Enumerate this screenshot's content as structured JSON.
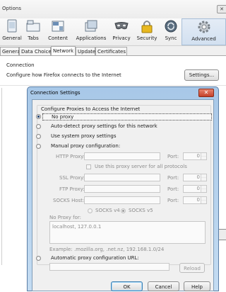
{
  "window": {
    "title": "Options",
    "close_glyph": "✕",
    "toolbar": [
      {
        "label": "General",
        "icon": "general-icon"
      },
      {
        "label": "Tabs",
        "icon": "tabs-icon"
      },
      {
        "label": "Content",
        "icon": "content-icon"
      },
      {
        "label": "Applications",
        "icon": "applications-icon"
      },
      {
        "label": "Privacy",
        "icon": "privacy-mask-icon"
      },
      {
        "label": "Security",
        "icon": "padlock-icon"
      },
      {
        "label": "Sync",
        "icon": "sync-icon"
      },
      {
        "label": "Advanced",
        "icon": "gear-icon",
        "selected": true
      }
    ],
    "subtabs": [
      {
        "label": "General"
      },
      {
        "label": "Data Choices"
      },
      {
        "label": "Network",
        "selected": true
      },
      {
        "label": "Update"
      },
      {
        "label": "Certificates"
      }
    ],
    "connection": {
      "heading": "Connection",
      "description": "Configure how Firefox connects to the Internet",
      "settings_button": "Settings..."
    }
  },
  "dialog": {
    "title": "Connection Settings",
    "close_glyph": "✕",
    "group_label": "Configure Proxies to Access the Internet",
    "options": {
      "no_proxy": "No proxy",
      "auto_detect": "Auto-detect proxy settings for this network",
      "system": "Use system proxy settings",
      "manual": "Manual proxy configuration:",
      "auto_url": "Automatic proxy configuration URL:"
    },
    "selected_option": "no_proxy",
    "labels": {
      "http_proxy": "HTTP Proxy:",
      "ssl_proxy": "SSL Proxy:",
      "ftp_proxy": "FTP Proxy:",
      "socks_host": "SOCKS Host:",
      "port": "Port:",
      "same_proxy": "Use this proxy server for all protocols",
      "socks_v4": "SOCKS v4",
      "socks_v5": "SOCKS v5",
      "no_proxy_for": "No Proxy for:",
      "example": "Example: .mozilla.org, .net.nz, 192.168.1.0/24"
    },
    "values": {
      "http_port": "0",
      "ssl_port": "0",
      "ftp_port": "0",
      "socks_port": "0",
      "no_proxy_for": "localhost, 127.0.0.1",
      "auto_url": ""
    },
    "buttons": {
      "reload": "Reload",
      "ok": "OK",
      "cancel": "Cancel",
      "help": "Help"
    }
  },
  "colors": {
    "dialog_frame": "#a8c8e8",
    "close_button": "#c5412a",
    "selected_tool": "#d2e0f0"
  }
}
